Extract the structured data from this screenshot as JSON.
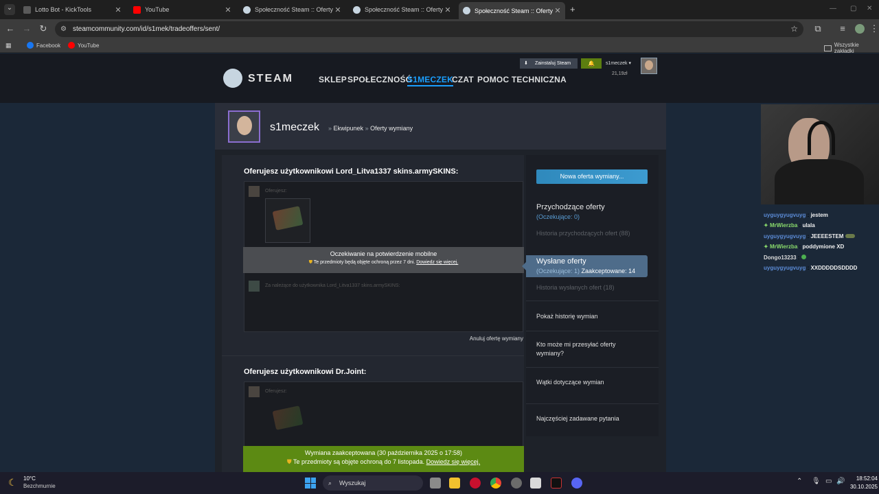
{
  "browser": {
    "tabs": [
      {
        "title": "Lotto Bot - KickTools",
        "color": "#5a5a5a"
      },
      {
        "title": "YouTube",
        "color": "#ff0000"
      },
      {
        "title": "Społeczność Steam :: Oferty wy",
        "color": "#1b2838"
      },
      {
        "title": "Społeczność Steam :: Oferty wy",
        "color": "#1b2838"
      },
      {
        "title": "Społeczność Steam :: Oferty wy",
        "color": "#1b2838"
      }
    ],
    "new_tab": "+",
    "url": "steamcommunity.com/id/s1mek/tradeoffers/sent/",
    "bookmarks": [
      {
        "label": "Facebook",
        "color": "#1877f2"
      },
      {
        "label": "YouTube",
        "color": "#ff0000"
      }
    ],
    "all_bookmarks": "Wszystkie zakładki"
  },
  "steam": {
    "logo": "STEAM",
    "menu": [
      "SKLEP",
      "SPOŁECZNOŚĆ",
      "S1MECZEK",
      "CZAT",
      "POMOC TECHNICZNA"
    ],
    "install": "Zainstaluj Steam",
    "account": "s1meczek",
    "wallet": "21,19zł",
    "accent": "#1a9fff"
  },
  "profile": {
    "name": "s1meczek",
    "crumb1": "Ekwipunek",
    "crumb2": "Oferty wymiany",
    "sep": "»"
  },
  "offers": [
    {
      "heading": "Oferujesz użytkownikowi Lord_Litva1337 skins.armySKINS:",
      "you_offer": "Oferujesz:",
      "status": "Oczekiwanie na potwierdzenie mobilne",
      "protection": "Te przedmioty będą objęte ochroną przez 7 dni.",
      "learn_more": "Dowiedz się więcej.",
      "receive": "Za należące do użytkownika Lord_Litva1337 skins.armySKINS:",
      "cancel": "Anuluj ofertę wymiany"
    },
    {
      "heading": "Oferujesz użytkownikowi Dr.Joint:",
      "you_offer": "Oferujesz:",
      "status": "Wymiana zaakceptowana (30 października 2025 o 17:58)",
      "protection": "Te przedmioty są objęte ochroną do 7 listopada.",
      "learn_more": "Dowiedz się więcej."
    }
  ],
  "sidebar": {
    "new_offer": "Nowa oferta wymiany...",
    "incoming_title": "Przychodzące oferty",
    "incoming_pending": "(Oczekujące: 0)",
    "incoming_history": "Historia przychodzących ofert (88)",
    "sent_title": "Wysłane oferty",
    "sent_pending": "(Oczekujące: 1)",
    "sent_accepted": "Zaakceptowane: 14",
    "sent_history": "Historia wysłanych ofert (18)",
    "trade_history": "Pokaż historię wymian",
    "who_can": "Kto może mi przesyłać oferty wymiany?",
    "threads": "Wątki dotyczące wymian",
    "faq": "Najczęściej zadawane pytania"
  },
  "chat": [
    {
      "user": "uyguygyugvuyg",
      "msg": "jestem",
      "cls": "u1"
    },
    {
      "user": "MrWierzba",
      "msg": "ulala",
      "cls": "u2"
    },
    {
      "user": "uyguygyugvuyg",
      "msg": "JEEEESTEM",
      "cls": "u1"
    },
    {
      "user": "MrWierzba",
      "msg": "poddymione XD",
      "cls": "u2"
    },
    {
      "user": "Dongo13233",
      "msg": "",
      "cls": "u3"
    },
    {
      "user": "uyguygyugvuyg",
      "msg": "XXDDDDDSDDDD",
      "cls": "u1"
    }
  ],
  "taskbar": {
    "temp": "10°C",
    "weather": "Bezchmurnie",
    "search": "Wyszukaj",
    "time": "18:52:04",
    "date": "30.10.2025"
  }
}
